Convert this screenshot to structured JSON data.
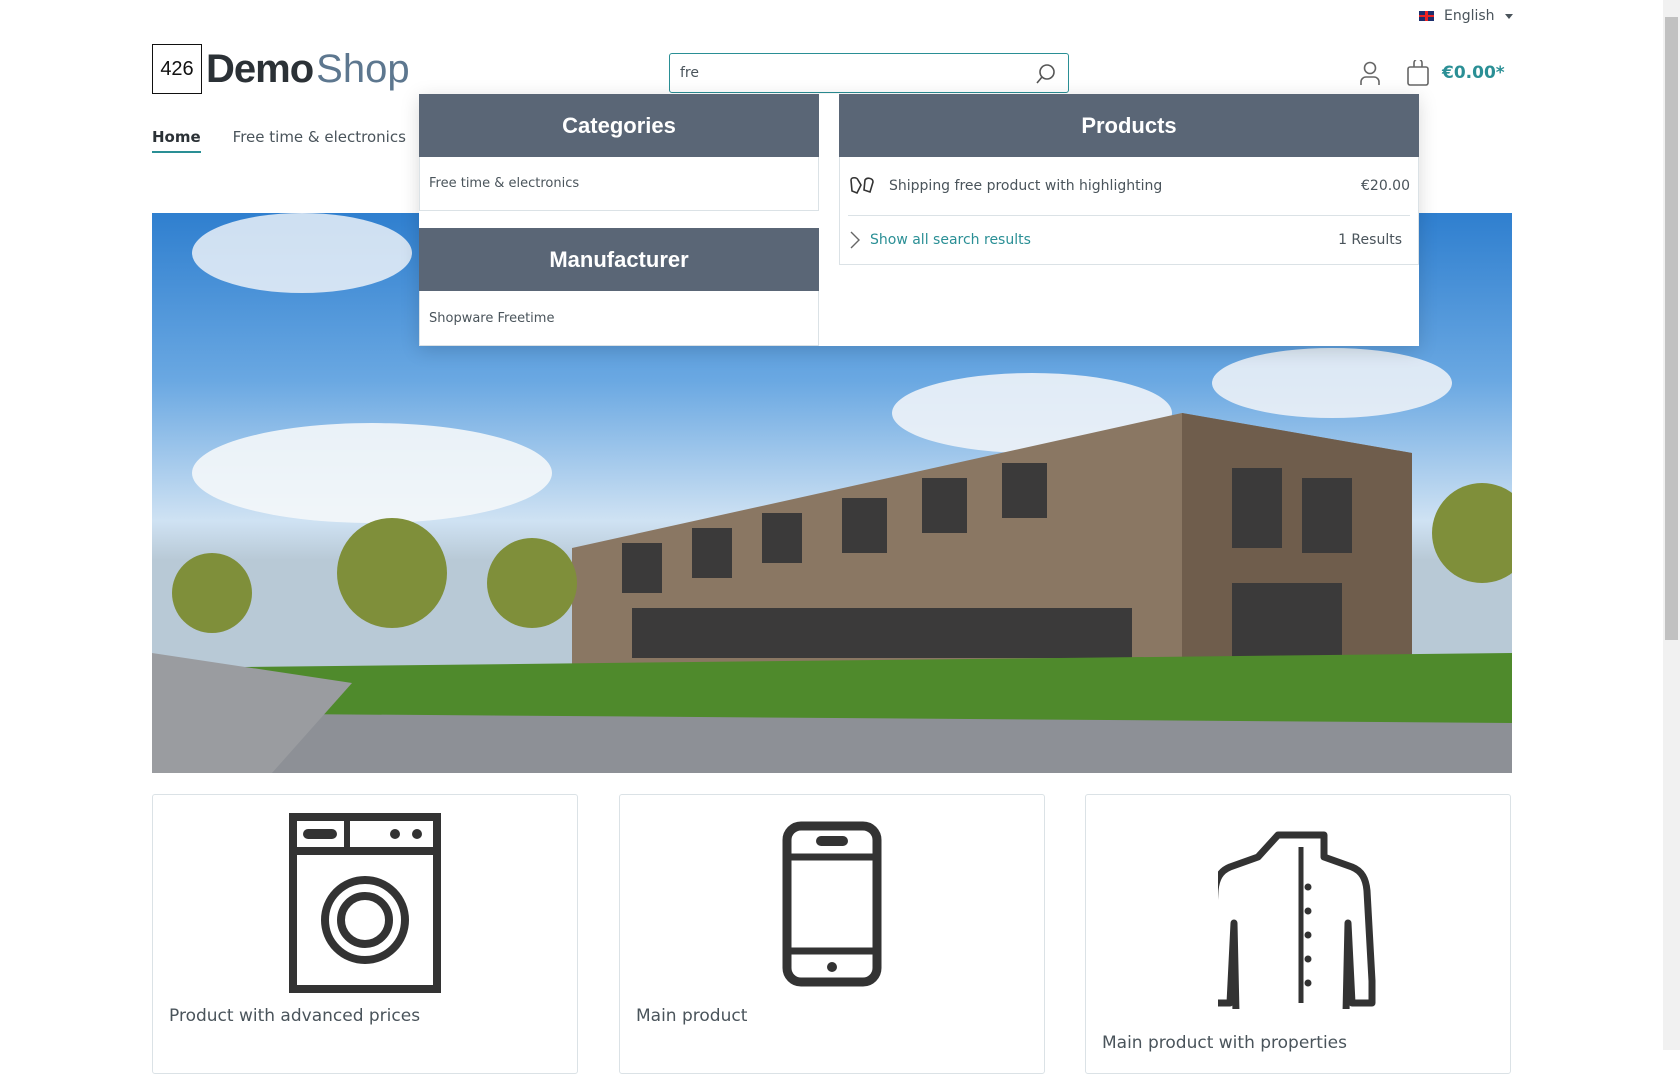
{
  "topbar": {
    "language": "English",
    "flag_icon": "uk-flag-icon"
  },
  "logo": {
    "number": "426",
    "brand_bold": "Demo",
    "brand_light": "Shop"
  },
  "search": {
    "value": "fre",
    "placeholder": ""
  },
  "header": {
    "cart_total": "€0.00*"
  },
  "nav": {
    "items": [
      {
        "label": "Home",
        "active": true
      },
      {
        "label": "Free time & electronics"
      }
    ]
  },
  "suggest": {
    "categories": {
      "title": "Categories",
      "items": [
        "Free time & electronics"
      ]
    },
    "manufacturer": {
      "title": "Manufacturer",
      "items": [
        "Shopware Freetime"
      ]
    },
    "products": {
      "title": "Products",
      "items": [
        {
          "name": "Shipping free product with highlighting",
          "price": "€20.00",
          "icon": "mittens-icon"
        }
      ],
      "show_all": "Show all search results",
      "results": "1 Results"
    }
  },
  "cards": [
    {
      "title": "Product with advanced prices",
      "icon": "washing-machine-icon"
    },
    {
      "title": "Main product",
      "icon": "smartphone-icon"
    },
    {
      "title": "Main product with properties",
      "icon": "jacket-icon"
    }
  ],
  "colors": {
    "accent": "#2a8f95",
    "header_bg": "#5a6676"
  }
}
